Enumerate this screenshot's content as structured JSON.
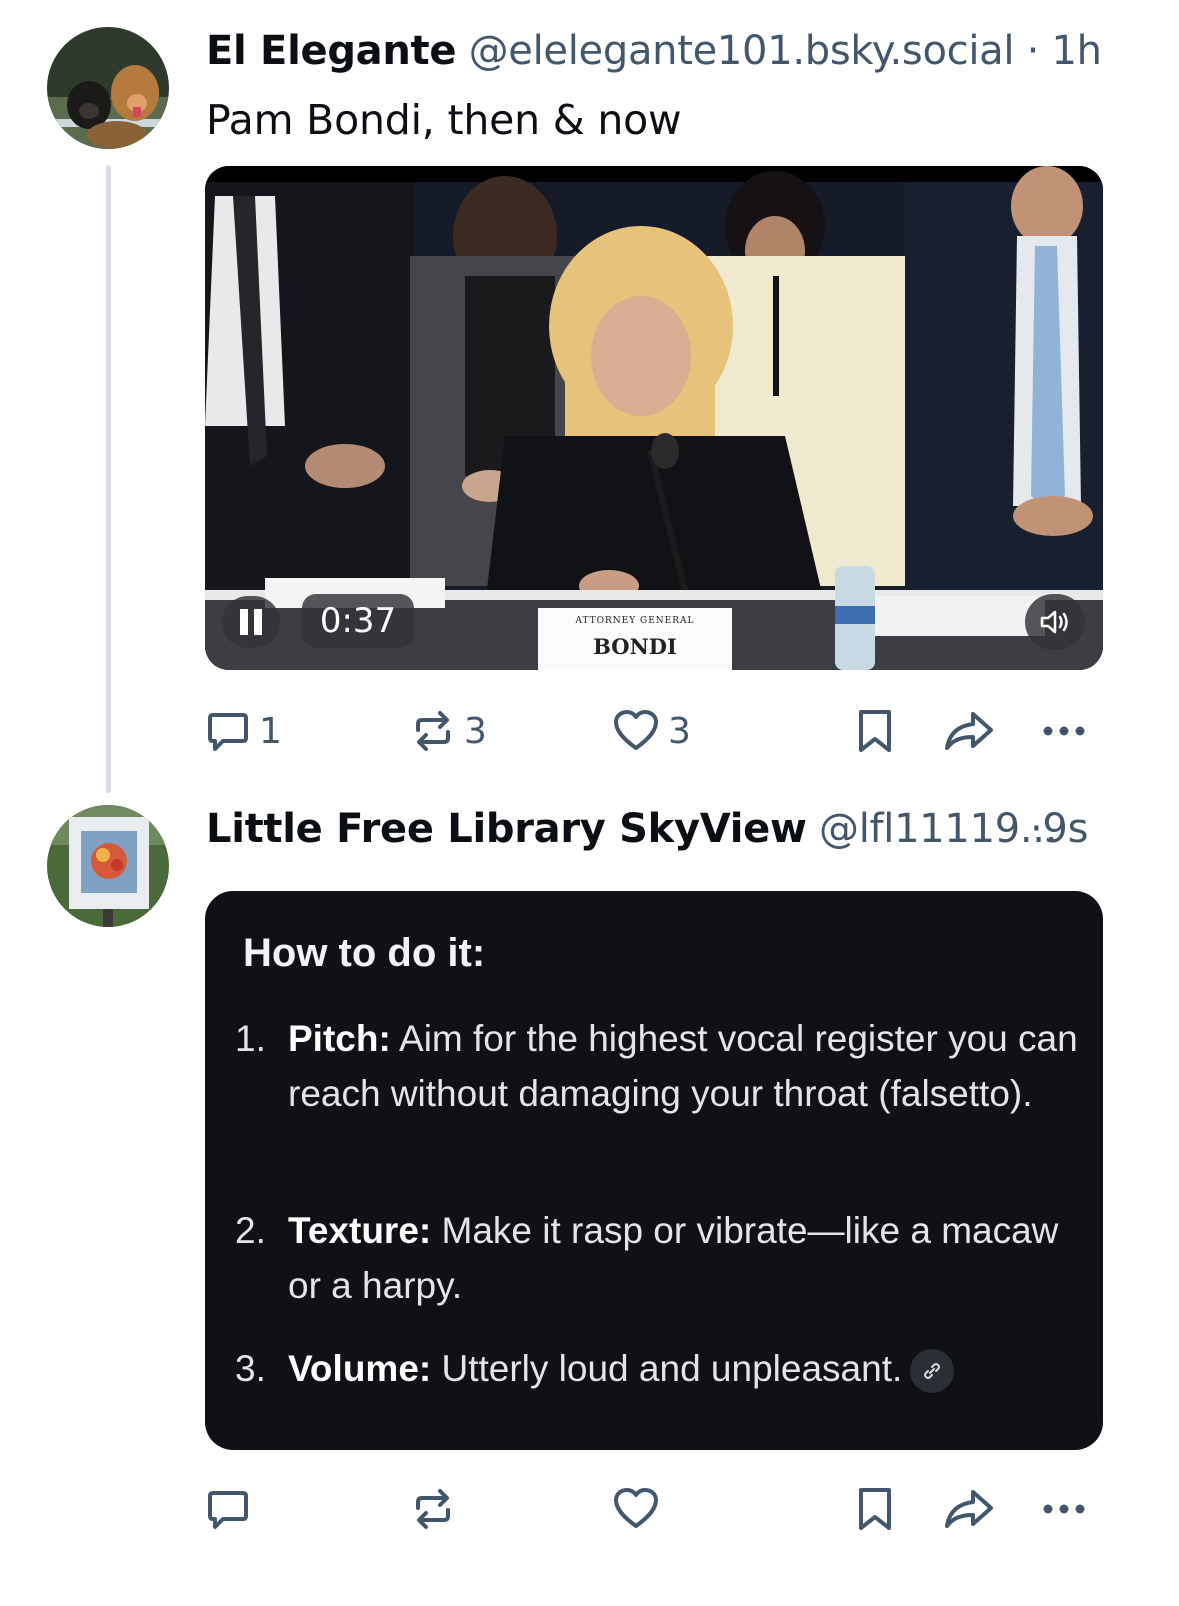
{
  "posts": [
    {
      "author": "El Elegante",
      "handle": "@elelegante101.bsky.social",
      "separator": "·",
      "time": "1h",
      "text": "Pam Bondi, then & now",
      "video": {
        "duration": "0:37",
        "placard_title": "ATTORNEY GENERAL",
        "placard_name": "BONDI",
        "icons": {
          "pause": "pause-icon",
          "mute": "speaker-icon"
        }
      },
      "actions": {
        "replies": "1",
        "reposts": "3",
        "likes": "3"
      }
    },
    {
      "author": "Little Free Library SkyView",
      "handle": "@lfl11119...",
      "separator": "·",
      "time": "9s",
      "card": {
        "title": "How to do it:",
        "items": [
          {
            "num": "1.",
            "label": "Pitch:",
            "text": "Aim for the highest vocal register you can reach without damaging your throat (falsetto)."
          },
          {
            "num": "2.",
            "label": "Texture:",
            "text": "Make it rasp or vibrate—like a macaw or a harpy."
          },
          {
            "num": "3.",
            "label": "Volume:",
            "text": "Utterly loud and unpleasant."
          }
        ]
      },
      "actions": {
        "replies": "",
        "reposts": "",
        "likes": ""
      }
    }
  ],
  "colors": {
    "muted": "#42576c",
    "thread_line": "#d8dce3",
    "card_bg": "#0f1116"
  }
}
